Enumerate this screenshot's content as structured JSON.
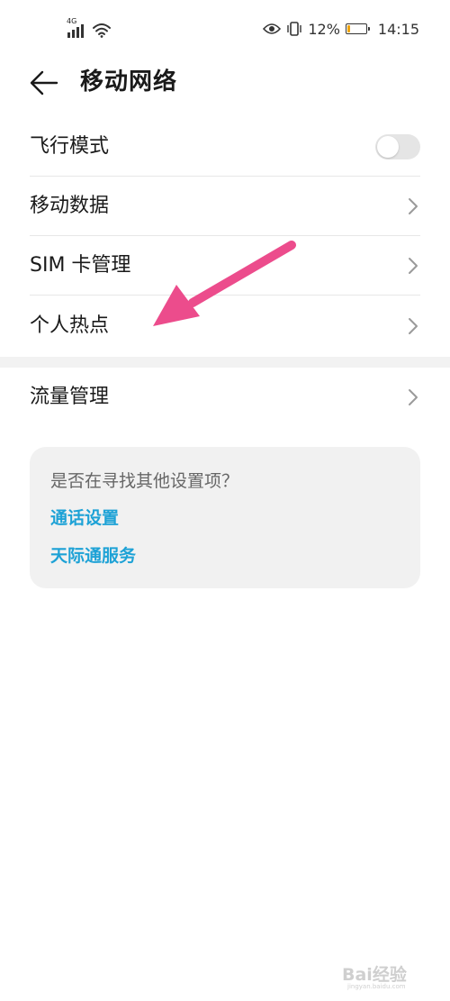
{
  "status_bar": {
    "network_label": "4G",
    "battery_percent_text": "12%",
    "battery_level": 0.12,
    "time": "14:15",
    "battery_color": "#f0a30a"
  },
  "header": {
    "back_icon": "arrow-left-icon",
    "title": "移动网络"
  },
  "list": {
    "airplane_mode": {
      "label": "飞行模式",
      "enabled": false
    },
    "mobile_data": {
      "label": "移动数据"
    },
    "sim_management": {
      "label": "SIM 卡管理"
    },
    "personal_hotspot": {
      "label": "个人热点"
    },
    "data_usage": {
      "label": "流量管理"
    }
  },
  "suggestion_card": {
    "title": "是否在寻找其他设置项？",
    "links": [
      "通话设置",
      "天际通服务"
    ],
    "link_color": "#1ea2d6"
  },
  "annotation": {
    "arrow_color": "#ec4c8c"
  },
  "watermark": {
    "text": "Bai经验",
    "subtext": "jingyan.baidu.com"
  }
}
